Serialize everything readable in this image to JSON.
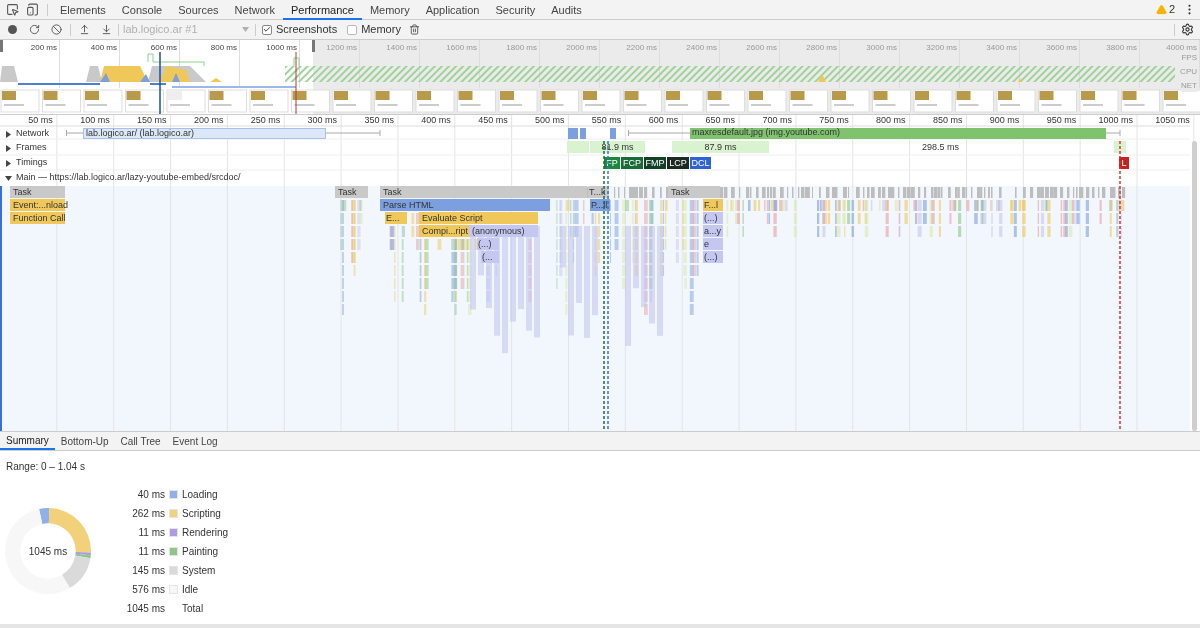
{
  "tabs": [
    {
      "label": "Elements",
      "selected": false
    },
    {
      "label": "Console",
      "selected": false
    },
    {
      "label": "Sources",
      "selected": false
    },
    {
      "label": "Network",
      "selected": false
    },
    {
      "label": "Performance",
      "selected": true
    },
    {
      "label": "Memory",
      "selected": false
    },
    {
      "label": "Application",
      "selected": false
    },
    {
      "label": "Security",
      "selected": false
    },
    {
      "label": "Audits",
      "selected": false
    }
  ],
  "warnings": {
    "count": "2"
  },
  "toolbar": {
    "profile_select": {
      "value": "lab.logico.ar #1",
      "disabled": true
    },
    "checkboxes": [
      {
        "label": "Screenshots",
        "checked": true
      },
      {
        "label": "Memory",
        "checked": false
      }
    ]
  },
  "overview": {
    "ticks": [
      "200 ms",
      "400 ms",
      "600 ms",
      "800 ms",
      "1000 ms",
      "1200 ms",
      "1400 ms",
      "1600 ms",
      "1800 ms",
      "2000 ms",
      "2200 ms",
      "2400 ms",
      "2600 ms",
      "2800 ms",
      "3000 ms",
      "3200 ms",
      "3400 ms",
      "3600 ms",
      "3800 ms",
      "4000 ms"
    ],
    "track_labels": [
      "FPS",
      "CPU",
      "NET"
    ]
  },
  "timeline": {
    "ticks": [
      "50 ms",
      "100 ms",
      "150 ms",
      "200 ms",
      "250 ms",
      "300 ms",
      "350 ms",
      "400 ms",
      "450 ms",
      "500 ms",
      "550 ms",
      "600 ms",
      "650 ms",
      "700 ms",
      "750 ms",
      "800 ms",
      "850 ms",
      "900 ms",
      "950 ms",
      "1000 ms",
      "1050 ms"
    ],
    "tracks": [
      {
        "label": "Network",
        "expanded": false
      },
      {
        "label": "Frames",
        "expanded": false
      },
      {
        "label": "Timings",
        "expanded": false
      },
      {
        "label": "Main — https://lab.logico.ar/lazy-youtube-embed/srcdoc/",
        "expanded": true
      }
    ],
    "network_requests": [
      {
        "label": "lab.logico.ar/ (lab.logico.ar)",
        "kind": "document"
      },
      {
        "label": "maxresdefault.jpg (img.youtube.com)",
        "kind": "image"
      }
    ],
    "frames": [
      "81.9 ms",
      "87.9 ms",
      "298.5 ms"
    ],
    "timing_markers": [
      {
        "label": "FP",
        "color": "#1a8a3a"
      },
      {
        "label": "FCP",
        "color": "#1a6b36"
      },
      {
        "label": "FMP",
        "color": "#124226"
      },
      {
        "label": "LCP",
        "color": "#1c2b22"
      },
      {
        "label": "DCL",
        "color": "#2f63d1"
      },
      {
        "label": "L",
        "color": "#c5221f"
      }
    ],
    "main_entries": [
      {
        "label": "Task",
        "kind": "system"
      },
      {
        "label": "Task",
        "kind": "system"
      },
      {
        "label": "Task",
        "kind": "system"
      },
      {
        "label": "T...k",
        "kind": "system"
      },
      {
        "label": "Task",
        "kind": "system"
      },
      {
        "label": "Event:...nload",
        "kind": "scripting"
      },
      {
        "label": "Parse HTML",
        "kind": "loading"
      },
      {
        "label": "P...ll",
        "kind": "loading"
      },
      {
        "label": "F...l",
        "kind": "scripting"
      },
      {
        "label": "Function Call",
        "kind": "scripting"
      },
      {
        "label": "E...",
        "kind": "scripting"
      },
      {
        "label": "Evaluate Script",
        "kind": "scripting"
      },
      {
        "label": "(...)",
        "kind": "js"
      },
      {
        "label": "Compi...ript",
        "kind": "scripting"
      },
      {
        "label": "(anonymous)",
        "kind": "js"
      },
      {
        "label": "a...y",
        "kind": "js"
      },
      {
        "label": "(...)",
        "kind": "js"
      },
      {
        "label": "e",
        "kind": "js"
      },
      {
        "label": "(...",
        "kind": "js"
      },
      {
        "label": "(...)",
        "kind": "js"
      }
    ]
  },
  "details_tabs": [
    {
      "label": "Summary",
      "selected": true
    },
    {
      "label": "Bottom-Up",
      "selected": false
    },
    {
      "label": "Call Tree",
      "selected": false
    },
    {
      "label": "Event Log",
      "selected": false
    }
  ],
  "summary": {
    "range": "Range: 0 – 1.04 s",
    "center_label": "1045 ms",
    "legend": [
      {
        "value": "40 ms",
        "label": "Loading",
        "color": "#8fb0e8"
      },
      {
        "value": "262 ms",
        "label": "Scripting",
        "color": "#f2d17a"
      },
      {
        "value": "11 ms",
        "label": "Rendering",
        "color": "#af9ae7"
      },
      {
        "value": "11 ms",
        "label": "Painting",
        "color": "#8cc787"
      },
      {
        "value": "145 ms",
        "label": "System",
        "color": "#dadada"
      },
      {
        "value": "576 ms",
        "label": "Idle",
        "color": "#f7f7f7"
      },
      {
        "value": "1045 ms",
        "label": "Total"
      }
    ]
  }
}
